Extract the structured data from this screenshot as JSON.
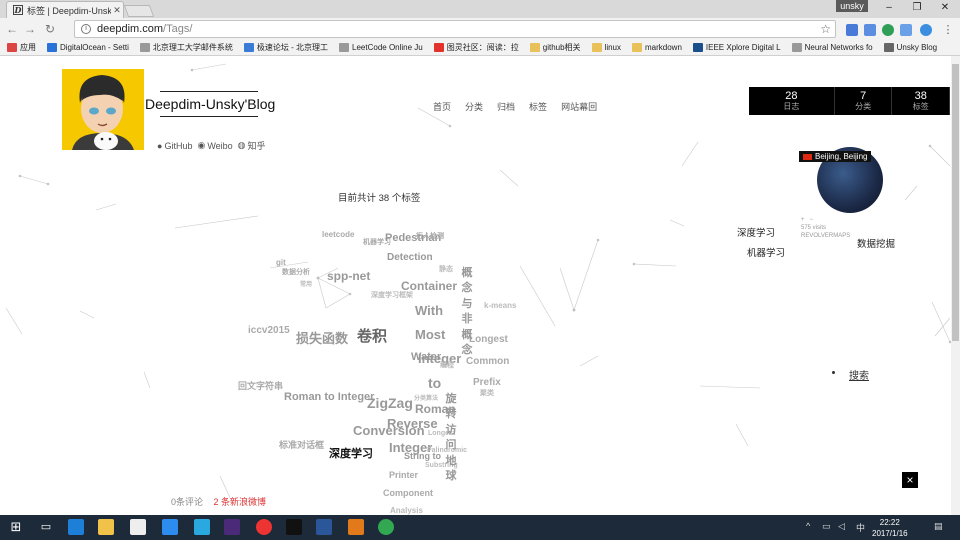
{
  "browser": {
    "tab_title": "标签 | Deepdim-Unsky",
    "tab_favicon": "D",
    "user": "unsky",
    "url_host": "deepdim.com",
    "url_path": "/Tags/",
    "bookmarks": [
      {
        "label": "应用",
        "color": "#d44"
      },
      {
        "label": "DigitalOcean - Setti",
        "color": "#2a72d8"
      },
      {
        "label": "北京理工大学邮件系统",
        "color": "#999"
      },
      {
        "label": "极速论坛 - 北京理工",
        "color": "#3a7bd5"
      },
      {
        "label": "LeetCode Online Ju",
        "color": "#999"
      },
      {
        "label": "图灵社区：阅读：拉",
        "color": "#e2322b"
      },
      {
        "label": "github相关",
        "color": "#e8c15a"
      },
      {
        "label": "linux",
        "color": "#e8c15a"
      },
      {
        "label": "markdown",
        "color": "#e8c15a"
      },
      {
        "label": "IEEE Xplore Digital L",
        "color": "#1b4f8c"
      },
      {
        "label": "Neural Networks fo",
        "color": "#999"
      },
      {
        "label": "Unsky Blog",
        "color": "#666"
      }
    ]
  },
  "site": {
    "title": "Deepdim-Unsky'Blog",
    "social": [
      "GitHub",
      "Weibo",
      "知乎"
    ],
    "menu": [
      "首页",
      "分类",
      "归档",
      "标签",
      "网站幕回"
    ],
    "stats": [
      {
        "num": "28",
        "label": "日志"
      },
      {
        "num": "7",
        "label": "分类"
      },
      {
        "num": "38",
        "label": "标签"
      }
    ]
  },
  "sidebar": {
    "location": "Beijing, Beijing",
    "revolver_visits": "575 visits",
    "revolver_brand": "REVOLVERMAPS",
    "categories": [
      "深度学习",
      "机器学习",
      "数据挖掘"
    ],
    "search": "搜索"
  },
  "tags": {
    "count_text": "目前共计 38 个标签",
    "items": [
      "leetcode",
      "机器学习",
      "Pedestrian",
      "行人检测",
      "Detection",
      "git",
      "数据分析",
      "spp-net",
      "常用",
      "深度学习框架",
      "Container",
      "With",
      "iccv2015",
      "损失函数",
      "卷积",
      "Most",
      "Water",
      "Integer",
      "to",
      "回文字符串",
      "Roman to Integer",
      "ZigZag",
      "Roman",
      "Reverse",
      "Conversion",
      "标准对话框",
      "Integer",
      "String to",
      "深度学习",
      "Printer",
      "Component",
      "Analysis",
      "k-means",
      "Longest",
      "Common",
      "Prefix",
      "Substring",
      "Palindromic",
      "Longest",
      "静态",
      "聚类",
      "编程",
      "分类算法",
      "概念与非概念",
      "旋转访问地球"
    ]
  },
  "footer": {
    "comments": "0条评论",
    "weibo": "2 条新浪微博",
    "close": "×"
  },
  "taskbar": {
    "time": "22:22",
    "date": "2017/1/16",
    "tray": [
      "中"
    ]
  }
}
